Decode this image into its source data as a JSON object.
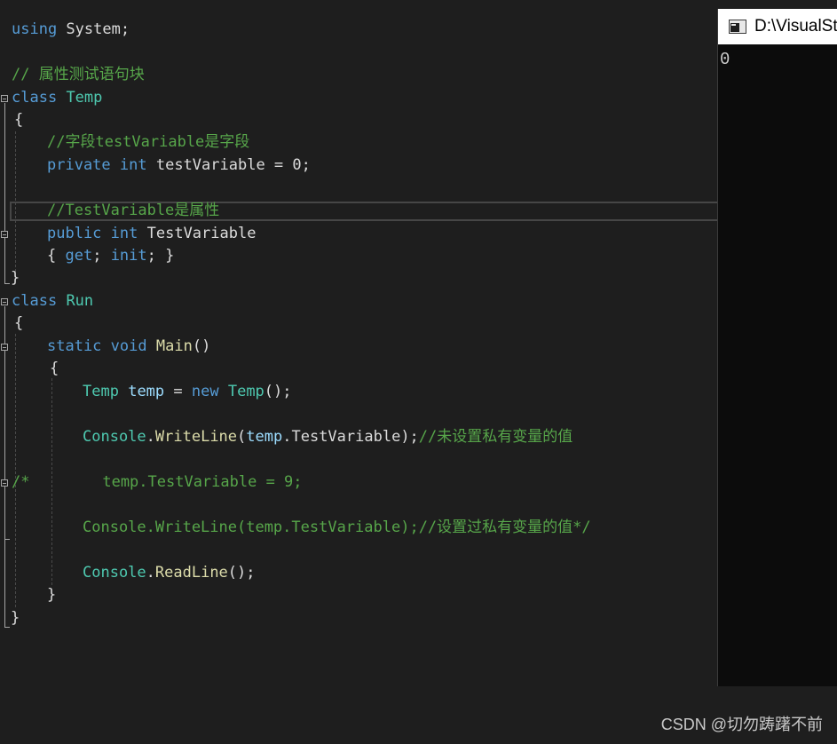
{
  "editor": {
    "l1": {
      "a": "using",
      "b": " System;"
    },
    "l3": {
      "a": "// 属性测试语句块"
    },
    "l4": {
      "a": "class",
      "b": " ",
      "c": "Temp"
    },
    "l5": {
      "a": "{"
    },
    "l6": {
      "a": "//字段testVariable是字段"
    },
    "l7": {
      "a": "private",
      "b": " ",
      "c": "int",
      "d": " testVariable = 0;"
    },
    "l9": {
      "a": "//TestVariable是属性"
    },
    "l10": {
      "a": "public",
      "b": " ",
      "c": "int",
      "d": " TestVariable"
    },
    "l11": {
      "a": "{ ",
      "b": "get",
      "c": "; ",
      "d": "init",
      "e": "; }"
    },
    "l12": {
      "a": "}"
    },
    "l13": {
      "a": "class",
      "b": " ",
      "c": "Run"
    },
    "l14": {
      "a": "{"
    },
    "l15": {
      "a": "static",
      "b": " ",
      "c": "void",
      "d": " ",
      "e": "Main",
      "f": "()"
    },
    "l16": {
      "a": "{"
    },
    "l17": {
      "a": "Temp",
      "b": " ",
      "c": "temp",
      "d": " = ",
      "e": "new",
      "f": " ",
      "g": "Temp",
      "h": "();"
    },
    "l19": {
      "a": "Console",
      "b": ".",
      "c": "WriteLine",
      "d": "(",
      "e": "temp",
      "f": ".",
      "g": "TestVariable",
      "h": ");",
      "i": "//未设置私有变量的值"
    },
    "l21": {
      "a": "/*        temp.TestVariable = 9;"
    },
    "l23": {
      "a": "Console.WriteLine(temp.TestVariable);//设置过私有变量的值*/"
    },
    "l25": {
      "a": "Console",
      "b": ".",
      "c": "ReadLine",
      "d": "();"
    },
    "l26": {
      "a": "}"
    },
    "l27": {
      "a": "}"
    }
  },
  "console": {
    "title": "D:\\VisualSt",
    "output": "0"
  },
  "watermark": "CSDN @切勿踌躇不前",
  "colors": {
    "background": "#1e1e1e",
    "keyword": "#569cd6",
    "type": "#4ec9b0",
    "comment": "#57a64a",
    "method": "#dcdcaa",
    "variable": "#9cdcfe"
  }
}
